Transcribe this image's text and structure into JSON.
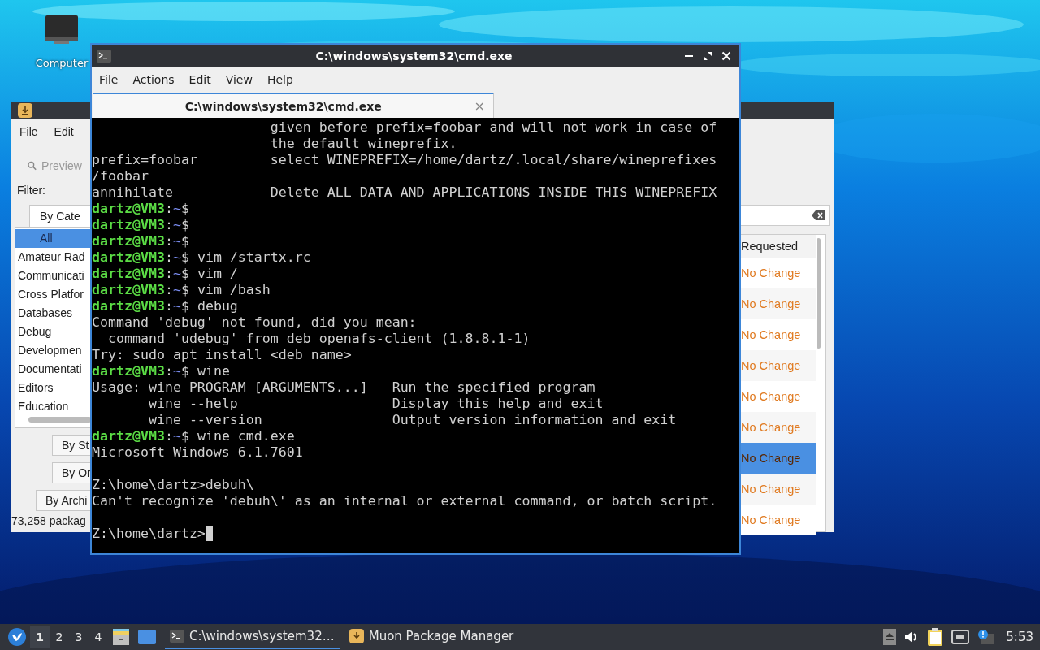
{
  "desktop_icons": [
    {
      "label": "Computer"
    }
  ],
  "muon_window": {
    "menu": [
      "File",
      "Edit"
    ],
    "search": {
      "placeholder": "Preview"
    },
    "filter_label": "Filter:",
    "category_tab": {
      "label": "By Cate",
      "selected": true
    },
    "categories": [
      {
        "label": "All",
        "selected": true
      },
      {
        "label": "Amateur Rad",
        "selected": false
      },
      {
        "label": "Communicati",
        "selected": false
      },
      {
        "label": "Cross Platfor",
        "selected": false
      },
      {
        "label": "Databases",
        "selected": false
      },
      {
        "label": "Debug",
        "selected": false
      },
      {
        "label": "Developmen",
        "selected": false
      },
      {
        "label": "Documentati",
        "selected": false
      },
      {
        "label": "Editors",
        "selected": false
      },
      {
        "label": "Education",
        "selected": false
      }
    ],
    "other_tabs": [
      {
        "label": "By St",
        "selected": false
      },
      {
        "label": "By Or",
        "selected": false
      },
      {
        "label": "By Archi",
        "selected": false
      }
    ],
    "status": "73,258 packag",
    "column_header": "Requested",
    "rows": [
      {
        "requested": "No Change",
        "selected": false
      },
      {
        "requested": "No Change",
        "selected": false
      },
      {
        "requested": "No Change",
        "selected": false
      },
      {
        "requested": "No Change",
        "selected": false
      },
      {
        "requested": "No Change",
        "selected": false
      },
      {
        "requested": "No Change",
        "selected": false
      },
      {
        "requested": "No Change",
        "selected": true
      },
      {
        "requested": "No Change",
        "selected": false
      },
      {
        "requested": "No Change",
        "selected": false
      }
    ]
  },
  "terminal_window": {
    "title": "C:\\windows\\system32\\cmd.exe",
    "menu": [
      "File",
      "Actions",
      "Edit",
      "View",
      "Help"
    ],
    "tab": {
      "label": "C:\\windows\\system32\\cmd.exe",
      "close": "×"
    },
    "lines": [
      {
        "kind": "output",
        "text": "                      given before prefix=foobar and will not work in case of"
      },
      {
        "kind": "output",
        "text": "                      the default wineprefix."
      },
      {
        "kind": "output",
        "text": "prefix=foobar         select WINEPREFIX=/home/dartz/.local/share/wineprefixes"
      },
      {
        "kind": "output",
        "text": "/foobar"
      },
      {
        "kind": "output",
        "text": "annihilate            Delete ALL DATA AND APPLICATIONS INSIDE THIS WINEPREFIX"
      },
      {
        "kind": "prompt",
        "host": "dartz@VM3",
        "sep": ":",
        "path": "~",
        "sign": "$"
      },
      {
        "kind": "prompt",
        "host": "dartz@VM3",
        "sep": ":",
        "path": "~",
        "sign": "$"
      },
      {
        "kind": "prompt",
        "host": "dartz@VM3",
        "sep": ":",
        "path": "~",
        "sign": "$"
      },
      {
        "kind": "prompt",
        "host": "dartz@VM3",
        "sep": ":",
        "path": "~",
        "sign": "$",
        "command": " vim /startx.rc"
      },
      {
        "kind": "prompt",
        "host": "dartz@VM3",
        "sep": ":",
        "path": "~",
        "sign": "$",
        "command": " vim /"
      },
      {
        "kind": "prompt",
        "host": "dartz@VM3",
        "sep": ":",
        "path": "~",
        "sign": "$",
        "command": " vim /bash"
      },
      {
        "kind": "prompt",
        "host": "dartz@VM3",
        "sep": ":",
        "path": "~",
        "sign": "$",
        "command": " debug"
      },
      {
        "kind": "output",
        "text": "Command 'debug' not found, did you mean:"
      },
      {
        "kind": "output",
        "text": "  command 'udebug' from deb openafs-client (1.8.8.1-1)"
      },
      {
        "kind": "output",
        "text": "Try: sudo apt install <deb name>"
      },
      {
        "kind": "prompt",
        "host": "dartz@VM3",
        "sep": ":",
        "path": "~",
        "sign": "$",
        "command": " wine"
      },
      {
        "kind": "output",
        "text": "Usage: wine PROGRAM [ARGUMENTS...]   Run the specified program"
      },
      {
        "kind": "output",
        "text": "       wine --help                   Display this help and exit"
      },
      {
        "kind": "output",
        "text": "       wine --version                Output version information and exit"
      },
      {
        "kind": "prompt",
        "host": "dartz@VM3",
        "sep": ":",
        "path": "~",
        "sign": "$",
        "command": " wine cmd.exe"
      },
      {
        "kind": "output",
        "text": "Microsoft Windows 6.1.7601"
      },
      {
        "kind": "blank"
      },
      {
        "kind": "output",
        "text": "Z:\\home\\dartz>debuh\\"
      },
      {
        "kind": "output",
        "text": "Can't recognize 'debuh\\' as an internal or external command, or batch script."
      },
      {
        "kind": "blank"
      },
      {
        "kind": "input",
        "text": "Z:\\home\\dartz>"
      }
    ]
  },
  "taskbar": {
    "workspaces": [
      {
        "label": "1",
        "selected": true
      },
      {
        "label": "2",
        "selected": false
      },
      {
        "label": "3",
        "selected": false
      },
      {
        "label": "4",
        "selected": false
      }
    ],
    "tasks": [
      {
        "label": "C:\\windows\\system32…",
        "kind": "terminal",
        "selected": true
      },
      {
        "label": "Muon Package Manager",
        "kind": "package",
        "selected": false
      }
    ],
    "clock": "5:53"
  }
}
